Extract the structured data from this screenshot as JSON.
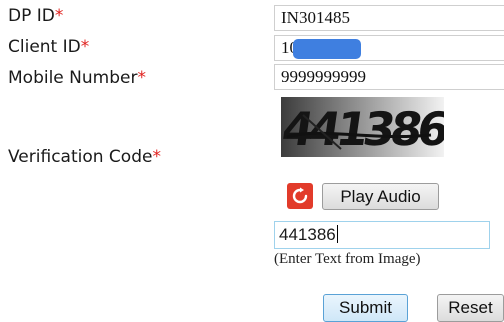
{
  "form": {
    "dp_id": {
      "label": "DP ID",
      "required_mark": "*",
      "value": "IN301485"
    },
    "client_id": {
      "label": "Client ID",
      "required_mark": "*",
      "value": "10"
    },
    "mobile_number": {
      "label": "Mobile Number",
      "required_mark": "*",
      "value": "9999999999"
    },
    "verification_code": {
      "label": "Verification Code",
      "required_mark": "*",
      "captcha_text": "441386",
      "play_audio_label": "Play Audio",
      "input_value": "441386",
      "hint": "(Enter Text from Image)"
    }
  },
  "actions": {
    "submit_label": "Submit",
    "reset_label": "Reset"
  },
  "icons": {
    "refresh": "refresh-icon"
  },
  "colors": {
    "required": "#e0221f",
    "refresh_button": "#e23b2a",
    "redaction": "#3f7fe0"
  }
}
